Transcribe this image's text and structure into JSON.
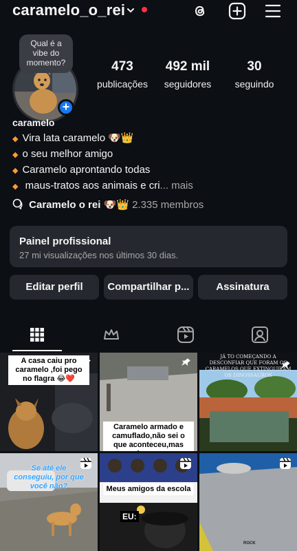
{
  "header": {
    "username": "caramelo_o_rei",
    "icons": [
      "threads-icon",
      "add-icon",
      "menu-icon"
    ]
  },
  "note": {
    "text": "Qual é a vibe do momento?"
  },
  "stats": {
    "posts": {
      "value": "473",
      "label": "publicações"
    },
    "followers": {
      "value": "492 mil",
      "label": "seguidores"
    },
    "following": {
      "value": "30",
      "label": "seguindo"
    }
  },
  "profile": {
    "display_name": "caramelo",
    "bio": [
      "Vira lata caramelo 🐶👑",
      "o seu melhor amigo",
      "Caramelo aprontando todas",
      " maus-tratos aos animais e cri"
    ],
    "more": "... mais",
    "community_name": "Caramelo o rei 🐶👑",
    "community_members": "2.335 membros"
  },
  "panel": {
    "title": "Painel profissional",
    "subtitle": "27 mi visualizações nos últimos 30 dias."
  },
  "buttons": {
    "edit": "Editar perfil",
    "share": "Compartilhar p...",
    "subscription": "Assinatura"
  },
  "tabs": [
    "grid-icon",
    "crown-icon",
    "reels-icon",
    "tagged-icon"
  ],
  "posts": [
    {
      "caption": "A casa caiu pro caramelo ,foi pego no flagra 😂❤️",
      "badge": "pin"
    },
    {
      "caption": "Caramelo armado e camuflado,não sei o que aconteceu,mas acho que a",
      "badge": "pin"
    },
    {
      "caption": "JÁ TO COMEÇANDO A DESCONFIAR QUE FORAM OS CARAMELOS QUE EXTINGUIRAM OS DINOSSAUROS",
      "badge": "pin"
    },
    {
      "caption": "Se até ele conseguiu, por que você não?",
      "badge": "reel"
    },
    {
      "caption": "Meus amigos da escola",
      "caption2": "EU:",
      "badge": "reel"
    },
    {
      "caption": "ROCK",
      "badge": "reel"
    }
  ],
  "colors": {
    "background": "#0c0f14",
    "surface": "#25282e",
    "accent": "#1877f2",
    "notification": "#ff3040",
    "bullet": "#ff9b2f"
  }
}
